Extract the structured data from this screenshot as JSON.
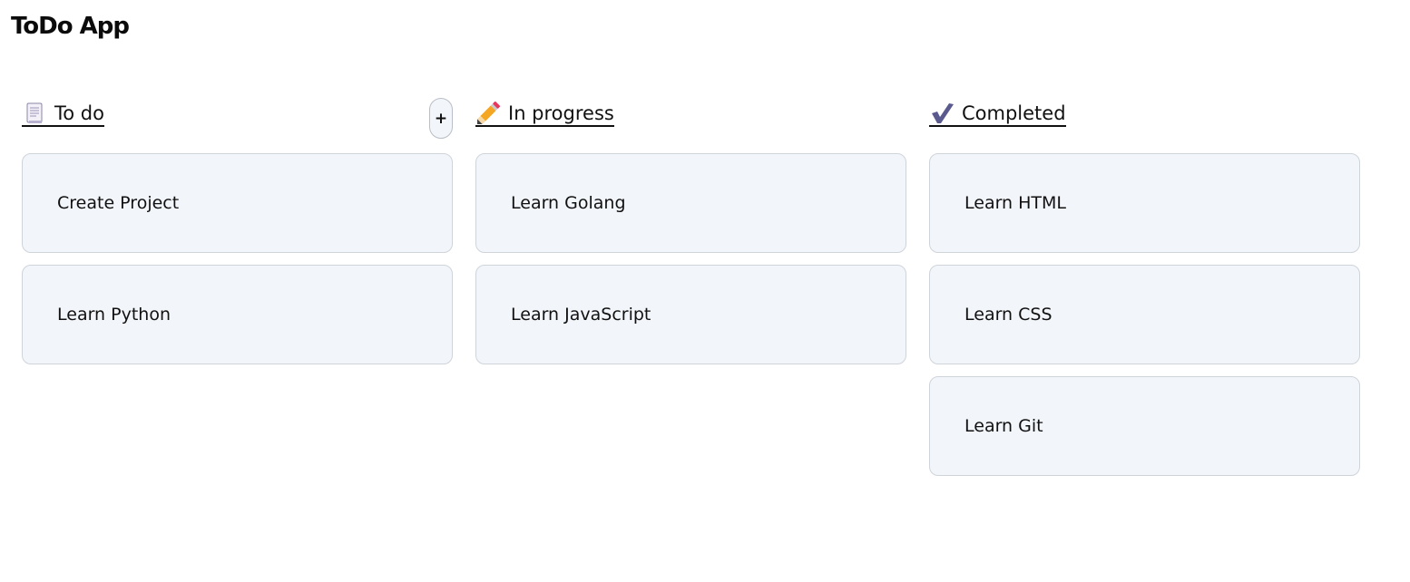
{
  "app": {
    "title": "ToDo App"
  },
  "columns": [
    {
      "id": "todo",
      "title": "To do",
      "icon": "document-icon",
      "add_button_label": "+",
      "cards": [
        "Create Project",
        "Learn Python"
      ]
    },
    {
      "id": "in-progress",
      "title": "In progress",
      "icon": "pencil-icon",
      "cards": [
        "Learn Golang",
        "Learn JavaScript"
      ]
    },
    {
      "id": "completed",
      "title": "Completed",
      "icon": "checkmark-icon",
      "cards": [
        "Learn HTML",
        "Learn CSS",
        "Learn Git"
      ]
    }
  ],
  "colors": {
    "card_background": "#f2f5f9",
    "card_border": "#cfd4db",
    "pencil_body": "#f5a623",
    "pencil_eraser": "#e8365d",
    "checkmark": "#5b5a8f"
  }
}
